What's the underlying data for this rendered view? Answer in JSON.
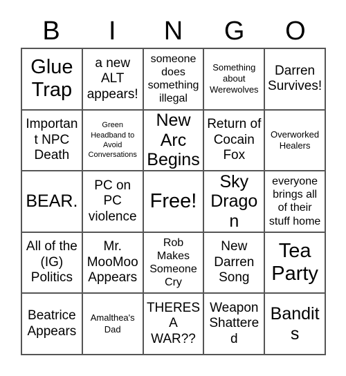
{
  "card": {
    "header_letters": [
      "B",
      "I",
      "N",
      "G",
      "O"
    ],
    "rows": [
      [
        {
          "text": "Glue Trap",
          "size": "xxl"
        },
        {
          "text": "a new ALT appears!",
          "size": "lg"
        },
        {
          "text": "someone does something illegal",
          "size": "md"
        },
        {
          "text": "Something about Werewolves",
          "size": "sm"
        },
        {
          "text": "Darren Survives!",
          "size": "lg"
        }
      ],
      [
        {
          "text": "Important NPC Death",
          "size": "lg"
        },
        {
          "text": "Green Headband to Avoid Conversations",
          "size": "xs"
        },
        {
          "text": "New Arc Begins",
          "size": "xl"
        },
        {
          "text": "Return of Cocain Fox",
          "size": "lg"
        },
        {
          "text": "Overworked Healers",
          "size": "sm"
        }
      ],
      [
        {
          "text": "BEAR.",
          "size": "xl"
        },
        {
          "text": "PC on PC violence",
          "size": "lg"
        },
        {
          "text": "Free!",
          "size": "xxl"
        },
        {
          "text": "Sky Dragon",
          "size": "xl"
        },
        {
          "text": "everyone brings all of their stuff home",
          "size": "md"
        }
      ],
      [
        {
          "text": "All of the (IG) Politics",
          "size": "lg"
        },
        {
          "text": "Mr. MooMoo Appears",
          "size": "lg"
        },
        {
          "text": "Rob Makes Someone Cry",
          "size": "md"
        },
        {
          "text": "New Darren Song",
          "size": "lg"
        },
        {
          "text": "Tea Party",
          "size": "xxl"
        }
      ],
      [
        {
          "text": "Beatrice Appears",
          "size": "lg"
        },
        {
          "text": "Amalthea's Dad",
          "size": "sm"
        },
        {
          "text": "THERES A WAR??",
          "size": "lg"
        },
        {
          "text": "Weapon Shattered",
          "size": "lg"
        },
        {
          "text": "Bandits",
          "size": "xl"
        }
      ]
    ]
  },
  "colors": {
    "border": "#555555",
    "background": "#ffffff",
    "text": "#000000"
  }
}
